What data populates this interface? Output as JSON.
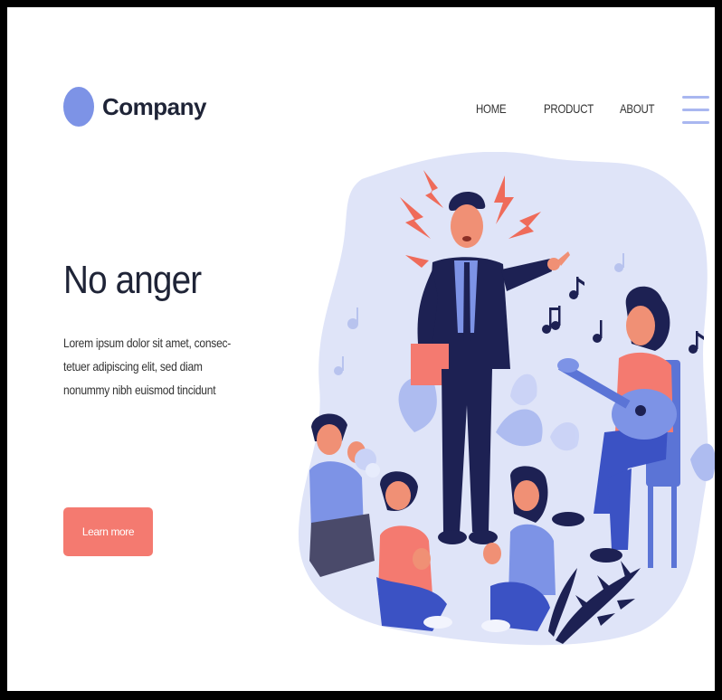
{
  "brand": {
    "name": "Company",
    "logo_color": "#7d93e6"
  },
  "nav": {
    "items": [
      "HOME",
      "PRODUCT",
      "ABOUT"
    ],
    "menu_icon": "hamburger-icon"
  },
  "hero": {
    "title": "No anger",
    "lines": [
      "Lorem ipsum dolor sit amet, consec-",
      "tetuer adipiscing elit, sed diam",
      "nonummy nibh euismod tincidunt"
    ],
    "cta_label": "Learn more"
  },
  "colors": {
    "accent": "#f47a70",
    "illustration_bg": "#dfe4f8",
    "text": "#1f2437",
    "suit": "#1d2153",
    "primary_blue": "#5b74d6"
  }
}
